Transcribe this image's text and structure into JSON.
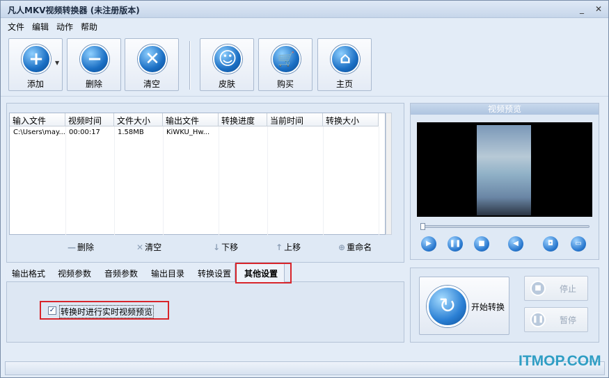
{
  "window": {
    "title": "凡人MKV视频转换器  (未注册版本)",
    "minimize": "_",
    "close": "✕"
  },
  "menu": [
    "文件",
    "编辑",
    "动作",
    "帮助"
  ],
  "toolbar": {
    "add": "添加",
    "delete": "删除",
    "clear": "清空",
    "skin": "皮肤",
    "buy": "购买",
    "home": "主页"
  },
  "file_table": {
    "columns": [
      "输入文件",
      "视频时间",
      "文件大小",
      "输出文件",
      "转换进度",
      "当前时间",
      "转换大小"
    ],
    "rows": [
      [
        "C:\\Users\\may...",
        "00:00:17",
        "1.58MB",
        "KiWKU_Hw...",
        "",
        "",
        ""
      ]
    ]
  },
  "list_actions": {
    "delete": "删除",
    "clear": "清空",
    "move_down": "下移",
    "move_up": "上移",
    "rename": "重命名"
  },
  "preview": {
    "title": "视频预览"
  },
  "tabs": [
    "输出格式",
    "视频参数",
    "音频参数",
    "输出目录",
    "转换设置",
    "其他设置"
  ],
  "active_tab": "其他设置",
  "other_settings": {
    "realtime_preview_label": "转换时进行实时视频预览",
    "realtime_preview_checked": true
  },
  "convert": {
    "start": "开始转换",
    "stop": "停止",
    "pause": "暂停"
  },
  "watermark": "ITMOP.COM"
}
